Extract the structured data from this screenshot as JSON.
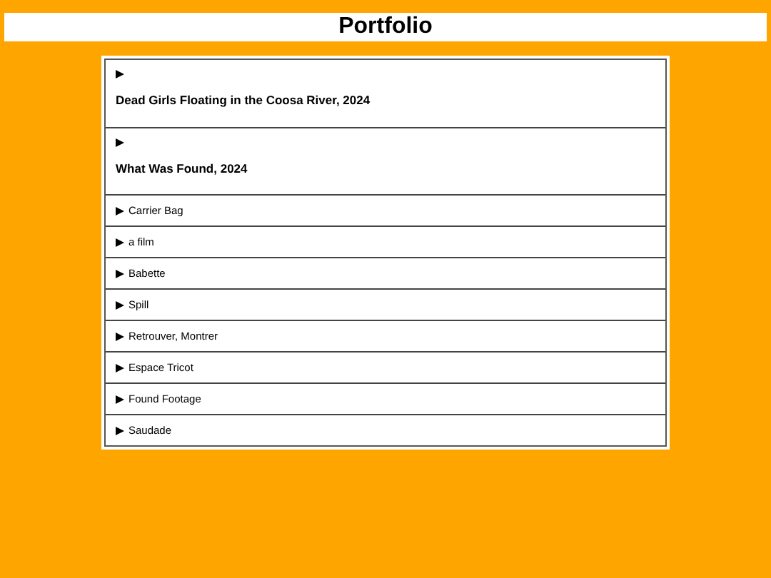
{
  "title": "Portfolio",
  "items": [
    {
      "kind": "heading",
      "label": "Dead Girls Floating in the Coosa River, 2024",
      "expanded": false
    },
    {
      "kind": "heading",
      "label": "What Was Found, 2024",
      "expanded": false
    },
    {
      "kind": "plain",
      "label": "Carrier Bag",
      "expanded": false
    },
    {
      "kind": "plain",
      "label": "a film",
      "expanded": false
    },
    {
      "kind": "plain",
      "label": "Babette",
      "expanded": false
    },
    {
      "kind": "plain",
      "label": "Spill",
      "expanded": false
    },
    {
      "kind": "plain",
      "label": "Retrouver, Montrer",
      "expanded": false
    },
    {
      "kind": "plain",
      "label": "Espace Tricot",
      "expanded": false
    },
    {
      "kind": "plain",
      "label": "Found Footage",
      "expanded": false
    },
    {
      "kind": "plain",
      "label": "Saudade",
      "expanded": false
    }
  ]
}
